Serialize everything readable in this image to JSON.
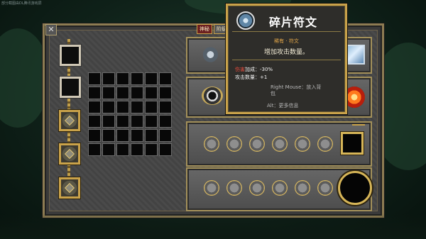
{
  "overlay": {
    "caption": "部分截图由DL腾讯游戏屏"
  },
  "window": {
    "close_glyph": "✕"
  },
  "tabs": [
    {
      "label": "神秘"
    },
    {
      "label": "阶级"
    }
  ],
  "equipment_slots": [
    {
      "kind": "empty"
    },
    {
      "kind": "empty"
    },
    {
      "kind": "gold"
    },
    {
      "kind": "gold"
    },
    {
      "kind": "gold"
    }
  ],
  "inventory": {
    "rows": 6,
    "cols": 6
  },
  "tooltip": {
    "title": "碎片符文",
    "rarity": "稀有 · 符文",
    "description": "增加攻击数量。",
    "stat1_prefix": "伤害",
    "stat1_suffix": "加成：-30%",
    "stat2": "攻击数量：+1",
    "hint_line1": "Right Mouse：放入背",
    "hint_line2": "包",
    "more_info": "Alt：更多信息",
    "icon": "rune-icon",
    "accent_color": "#c9a24a",
    "red_color": "#e24a3c"
  }
}
